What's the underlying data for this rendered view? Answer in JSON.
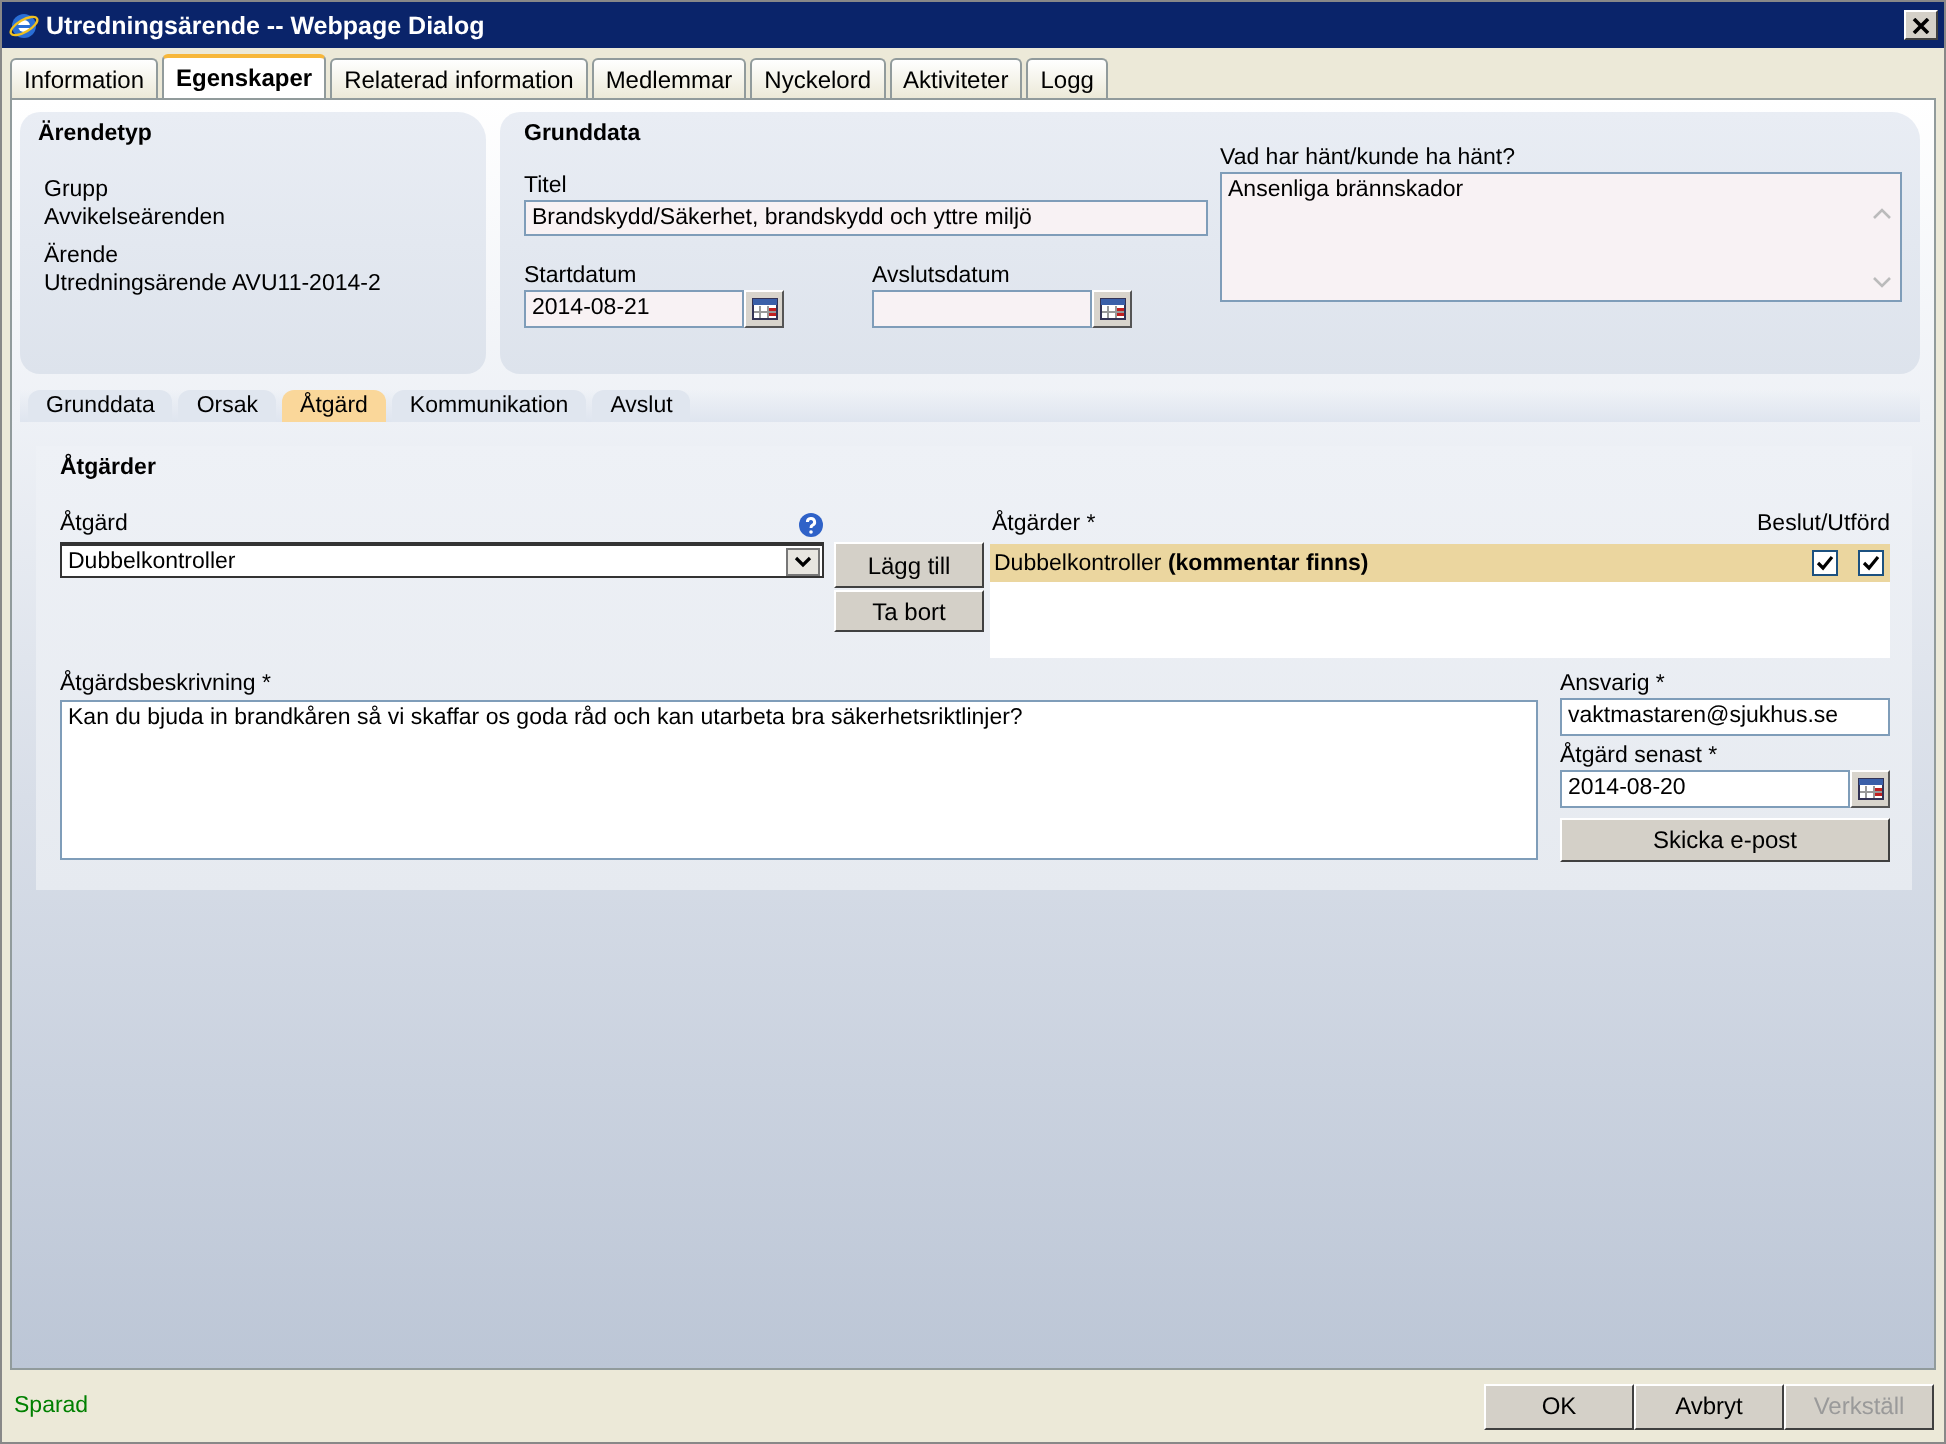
{
  "window": {
    "title": "Utredningsärende -- Webpage Dialog"
  },
  "tabs": [
    {
      "label": "Information",
      "selected": false
    },
    {
      "label": "Egenskaper",
      "selected": true
    },
    {
      "label": "Relaterad information",
      "selected": false
    },
    {
      "label": "Medlemmar",
      "selected": false
    },
    {
      "label": "Nyckelord",
      "selected": false
    },
    {
      "label": "Aktiviteter",
      "selected": false
    },
    {
      "label": "Logg",
      "selected": false
    }
  ],
  "case_type": {
    "heading": "Ärendetyp",
    "fields": [
      {
        "label": "Grupp",
        "value": "Avvikelseärenden"
      },
      {
        "label": "Ärende",
        "value": "Utredningsärende AVU11-2014-2"
      }
    ]
  },
  "basic_data": {
    "heading": "Grunddata",
    "title": {
      "label": "Titel",
      "value": "Brandskydd/Säkerhet, brandskydd och yttre miljö"
    },
    "start_date": {
      "label": "Startdatum",
      "value": "2014-08-21"
    },
    "end_date": {
      "label": "Avslutsdatum"
    },
    "what_happened": {
      "label": "Vad har hänt/kunde ha hänt?",
      "value": "Ansenliga brännskador"
    }
  },
  "sub_tabs": [
    {
      "label": "Grunddata",
      "selected": false
    },
    {
      "label": "Orsak",
      "selected": false
    },
    {
      "label": "Åtgärd",
      "selected": true
    },
    {
      "label": "Kommunikation",
      "selected": false
    },
    {
      "label": "Avslut",
      "selected": false
    }
  ],
  "actions": {
    "heading": "Åtgärder",
    "action_select": {
      "label": "Åtgärd",
      "value": "Dubbelkontroller"
    },
    "buttons": [
      {
        "label": "Lägg till"
      },
      {
        "label": "Ta bort"
      }
    ],
    "list": {
      "label": "Åtgärder *",
      "column": "Beslut/Utförd",
      "items": [
        {
          "text": "Dubbelkontroller **(kommentar finns)**",
          "selected": true,
          "decided": true,
          "done": true
        }
      ]
    },
    "description": {
      "label": "Åtgärdsbeskrivning *",
      "value": "Kan du bjuda in brandkåren så vi skaffar os goda råd och kan utarbeta bra säkerhetsriktlinjer?"
    },
    "responsible": {
      "label": "Ansvarig *",
      "value": "vaktmastaren@sjukhus.se"
    },
    "deadline": {
      "label": "Åtgärd senast *",
      "value": "2014-08-20"
    },
    "send_button": "Skicka e-post"
  },
  "status_bar": {
    "status": "Sparad",
    "buttons": [
      {
        "label": "OK",
        "disabled": false
      },
      {
        "label": "Avbryt",
        "disabled": false
      },
      {
        "label": "Verkställ",
        "disabled": true
      }
    ]
  }
}
